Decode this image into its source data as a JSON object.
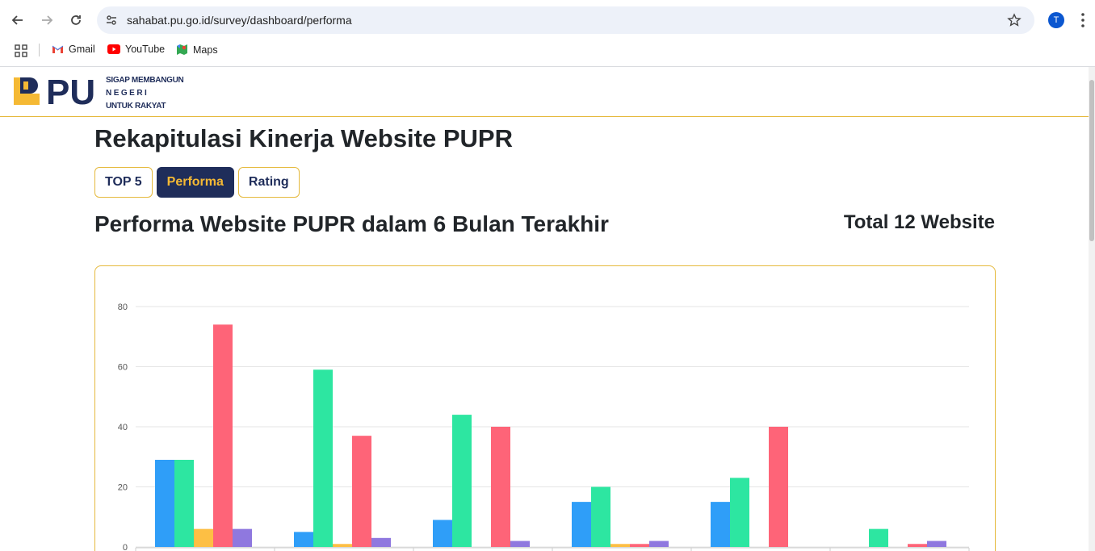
{
  "browser": {
    "url": "sahabat.pu.go.id/survey/dashboard/performa",
    "avatar_letter": "T",
    "bookmarks": [
      {
        "label": "Gmail",
        "icon": "gmail-icon"
      },
      {
        "label": "YouTube",
        "icon": "youtube-icon"
      },
      {
        "label": "Maps",
        "icon": "maps-icon"
      }
    ]
  },
  "site": {
    "logo_letters": "PU",
    "logo_tagline": [
      "SIGAP MEMBANGUN",
      "NEGERI",
      "UNTUK RAKYAT"
    ],
    "page_title": "Rekapitulasi Kinerja Website PUPR",
    "tabs": [
      {
        "label": "TOP 5",
        "active": false
      },
      {
        "label": "Performa",
        "active": true
      },
      {
        "label": "Rating",
        "active": false
      }
    ],
    "section_title": "Performa Website PUPR dalam 6 Bulan Terakhir",
    "total_label": "Total 12 Website"
  },
  "colors": {
    "brand_navy": "#1f2d5a",
    "brand_yellow": "#f5b934",
    "series": [
      "#2f9ef8",
      "#2de6a1",
      "#fdbf44",
      "#fe6478",
      "#8f78df"
    ]
  },
  "chart_data": {
    "type": "bar",
    "groups": 6,
    "series": [
      {
        "values": [
          29,
          5,
          9,
          15,
          15,
          0
        ]
      },
      {
        "values": [
          29,
          59,
          44,
          20,
          23,
          6
        ]
      },
      {
        "values": [
          6,
          1,
          0,
          1,
          0,
          0
        ]
      },
      {
        "values": [
          74,
          37,
          40,
          1,
          40,
          1
        ]
      },
      {
        "values": [
          6,
          3,
          2,
          2,
          0,
          2
        ]
      }
    ],
    "y_ticks": [
      "0",
      "20",
      "40",
      "60",
      "80"
    ],
    "ylim": [
      0,
      80
    ],
    "grid": true
  }
}
